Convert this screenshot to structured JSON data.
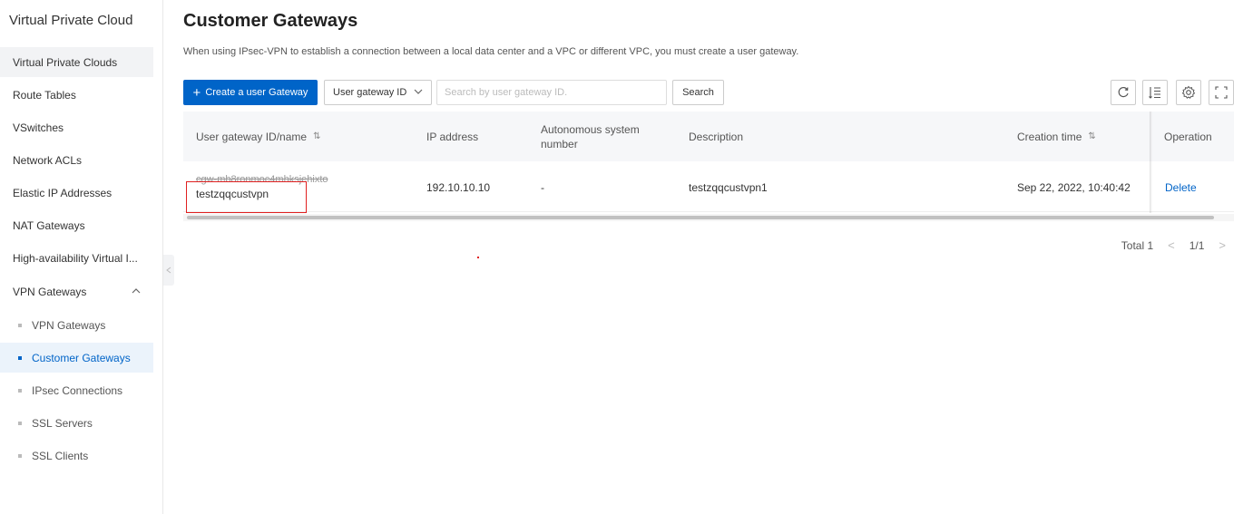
{
  "sidebar": {
    "title": "Virtual Private Cloud",
    "items": [
      {
        "label": "Virtual Private Clouds"
      },
      {
        "label": "Route Tables"
      },
      {
        "label": "VSwitches"
      },
      {
        "label": "Network ACLs"
      },
      {
        "label": "Elastic IP Addresses"
      },
      {
        "label": "NAT Gateways"
      },
      {
        "label": "High-availability Virtual I..."
      }
    ],
    "group": {
      "label": "VPN Gateways",
      "icon": "chevron-up-icon"
    },
    "sub_items": [
      {
        "label": "VPN Gateways"
      },
      {
        "label": "Customer Gateways"
      },
      {
        "label": "IPsec Connections"
      },
      {
        "label": "SSL Servers"
      },
      {
        "label": "SSL Clients"
      }
    ]
  },
  "header": {
    "title": "Customer Gateways",
    "description": "When using IPsec-VPN to establish a connection between a local data center and a VPC or different VPC, you must create a user gateway."
  },
  "toolbar": {
    "create_label": "Create a user Gateway",
    "filter_select": "User gateway ID",
    "search_placeholder": "Search by user gateway ID.",
    "search_label": "Search",
    "icons": [
      "refresh-icon",
      "column-settings-icon",
      "settings-icon",
      "fullscreen-icon"
    ]
  },
  "table": {
    "columns": [
      "User gateway ID/name",
      "IP address",
      "Autonomous system number",
      "Description",
      "Creation time",
      "Operation"
    ],
    "rows": [
      {
        "id": "cgw-mb8ronmoc4mhksjehixto",
        "name": "testzqqcustvpn",
        "ip": "192.10.10.10",
        "asn": "-",
        "description": "testzqqcustvpn1",
        "created": "Sep 22, 2022, 10:40:42",
        "operation": "Delete"
      }
    ]
  },
  "pagination": {
    "total_label": "Total 1",
    "page_label": "1/1"
  },
  "colors": {
    "primary": "#0064c8",
    "highlight_box": "#e02020"
  }
}
